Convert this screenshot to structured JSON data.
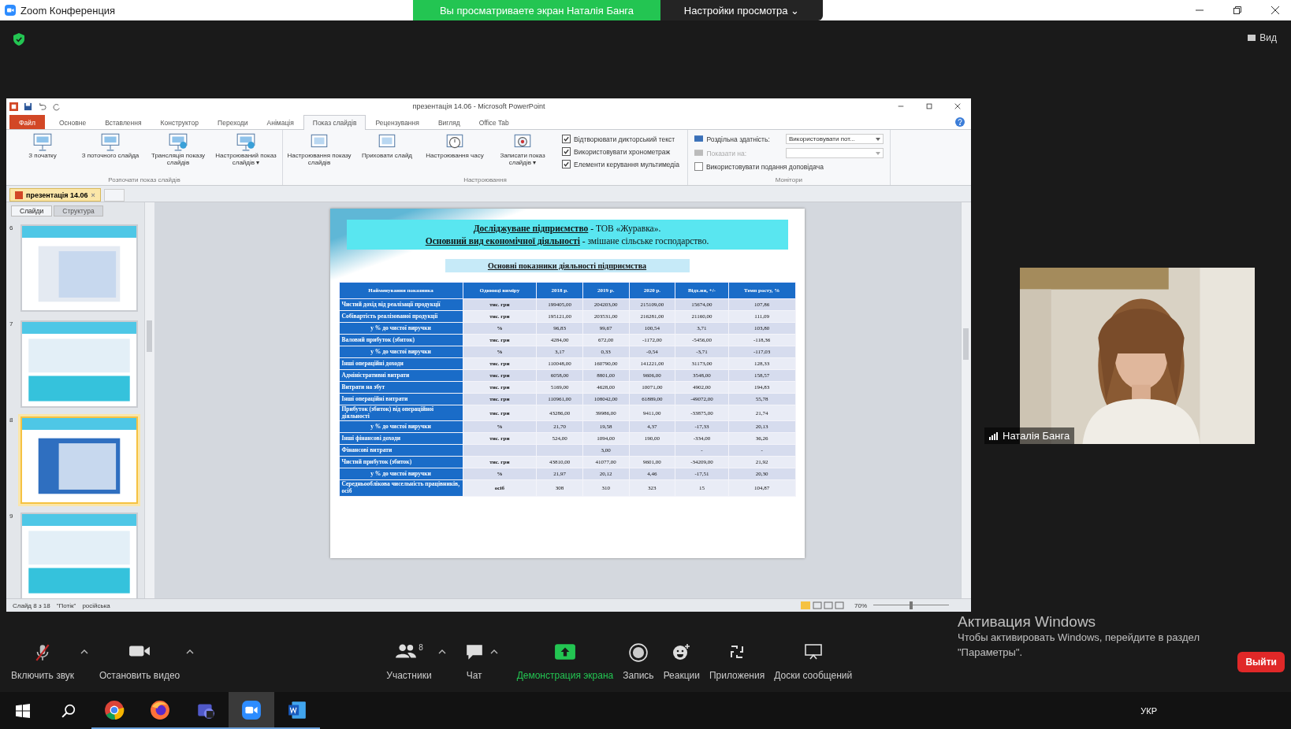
{
  "zoom_window": {
    "title": "Zoom Конференция",
    "banner": "Вы просматриваете экран Наталія Банга",
    "view_options": "Настройки просмотра",
    "view_options_caret": "⌄",
    "view_button": "Вид"
  },
  "powerpoint": {
    "title": "презентація 14.06 - Microsoft PowerPoint",
    "tabs": [
      {
        "label": "Файл",
        "selected": false,
        "kind": "file"
      },
      {
        "label": "Основне",
        "selected": false,
        "kind": "tab"
      },
      {
        "label": "Вставлення",
        "selected": false,
        "kind": "tab"
      },
      {
        "label": "Конструктор",
        "selected": false,
        "kind": "tab"
      },
      {
        "label": "Переходи",
        "selected": false,
        "kind": "tab"
      },
      {
        "label": "Анімація",
        "selected": false,
        "kind": "tab"
      },
      {
        "label": "Показ слайдів",
        "selected": true,
        "kind": "tab"
      },
      {
        "label": "Рецензування",
        "selected": false,
        "kind": "tab"
      },
      {
        "label": "Вигляд",
        "selected": false,
        "kind": "tab"
      },
      {
        "label": "Office Tab",
        "selected": false,
        "kind": "tab"
      }
    ],
    "start_group": {
      "label": "Розпочати показ слайдів",
      "buttons": [
        "З початку",
        "З поточного слайда",
        "Трансляція показу слайдів",
        "Настроюваний показ слайдів ▾"
      ]
    },
    "setup_group": {
      "label": "Настроювання",
      "buttons": [
        "Настроювання показу слайдів",
        "Приховати слайд",
        "Настроювання часу",
        "Записати показ слайдів ▾"
      ],
      "checkboxes": [
        {
          "label": "Відтворювати дикторський текст",
          "checked": true
        },
        {
          "label": "Використовувати хронометраж",
          "checked": true
        },
        {
          "label": "Елементи керування мультимедіа",
          "checked": true
        }
      ]
    },
    "monitors_group": {
      "label": "Монітори",
      "resolution_label": "Роздільна здатність:",
      "resolution_value": "Використовувати пот...",
      "show_on_label": "Показати на:",
      "presenter_view": {
        "label": "Використовувати подання доповідача",
        "checked": false
      }
    },
    "document_tab": "презентація 14.06",
    "document_tab_close": "×",
    "panel_tabs": [
      {
        "label": "Слайди",
        "selected": true
      },
      {
        "label": "Структура",
        "selected": false
      }
    ],
    "slides": [
      {
        "number": "6",
        "selected": false
      },
      {
        "number": "7",
        "selected": false
      },
      {
        "number": "8",
        "selected": true
      },
      {
        "number": "9",
        "selected": false
      }
    ],
    "slide": {
      "heading": [
        "**Досліджуване підприємство** - ТОВ «Журавка».",
        "**Основний вид економічної діяльності** - змішане сільське господарство."
      ],
      "subtitle": "Основні показники діяльності підприємства",
      "table": {
        "columns": [
          "Найменування показника",
          "Одиниці виміру",
          "2018 р.",
          "2019 р.",
          "2020 р.",
          "Відх.ня, +/-",
          "Темп росту, %"
        ],
        "rows": [
          {
            "kind": "main",
            "cells": [
              "Чистий дохід від реалізації продукції",
              "тис. грн",
              "199405,00",
              "204203,00",
              "215109,00",
              "15674,00",
              "107,86"
            ]
          },
          {
            "kind": "main",
            "cells": [
              "Собівартість реалізованої продукції",
              "тис. грн",
              "195121,00",
              "203531,00",
              "216281,00",
              "21160,00",
              "111,09"
            ]
          },
          {
            "kind": "sub",
            "cells": [
              "у % до чистої виручки",
              "%",
              "96,83",
              "99,67",
              "100,54",
              "3,71",
              "103,80"
            ]
          },
          {
            "kind": "main",
            "cells": [
              "Валовий прибуток (збиток)",
              "тис. грн",
              "4284,00",
              "672,00",
              "-1172,00",
              "-5456,00",
              "-118,36"
            ]
          },
          {
            "kind": "sub",
            "cells": [
              "у % до чистої виручки",
              "%",
              "3,17",
              "0,33",
              "-0,54",
              "-3,71",
              "-117,03"
            ]
          },
          {
            "kind": "main",
            "cells": [
              "Інші операційні доходи",
              "тис. грн",
              "110048,00",
              "160790,00",
              "141221,00",
              "31173,00",
              "128,33"
            ]
          },
          {
            "kind": "main",
            "cells": [
              "Адміністративні витрати",
              "тис. грн",
              "6058,00",
              "8801,00",
              "9606,00",
              "3548,00",
              "158,57"
            ]
          },
          {
            "kind": "main",
            "cells": [
              "Витрати на збут",
              "тис. грн",
              "5169,00",
              "4628,00",
              "10071,00",
              "4902,00",
              "194,83"
            ]
          },
          {
            "kind": "main",
            "cells": [
              "Інші операційні витрати",
              "тис. грн",
              "110961,00",
              "108042,00",
              "61889,00",
              "-49072,00",
              "55,78"
            ]
          },
          {
            "kind": "main",
            "cells": [
              "Прибуток (збиток) від операційної діяльності",
              "тис. грн",
              "43286,00",
              "39986,00",
              "9411,00",
              "-33875,00",
              "21,74"
            ]
          },
          {
            "kind": "sub",
            "cells": [
              "у % до чистої виручки",
              "%",
              "21,70",
              "19,58",
              "4,37",
              "-17,33",
              "20,13"
            ]
          },
          {
            "kind": "main",
            "cells": [
              "Інші фінансові доходи",
              "тис. грн",
              "524,00",
              "1094,00",
              "190,00",
              "-334,00",
              "36,26"
            ]
          },
          {
            "kind": "main",
            "cells": [
              "Фінансові витрати",
              "",
              "",
              "3,00",
              "",
              "-",
              "-"
            ]
          },
          {
            "kind": "main",
            "cells": [
              "Чистий прибуток (збиток)",
              "тис. грн",
              "43810,00",
              "41077,00",
              "9601,00",
              "-34209,00",
              "21,92"
            ]
          },
          {
            "kind": "sub",
            "cells": [
              "у % до чистої виручки",
              "%",
              "21,97",
              "20,12",
              "4,46",
              "-17,51",
              "20,30"
            ]
          },
          {
            "kind": "main",
            "cells": [
              "Середньооблікова чисельність працівників, осіб",
              "осіб",
              "308",
              "310",
              "323",
              "15",
              "104,87"
            ]
          }
        ]
      }
    },
    "status": [
      "Слайд 8 з 18",
      "\"Потік\"",
      "російська"
    ],
    "zoom_level": "70%",
    "zoom_slider": {
      "level": 0.5
    }
  },
  "participant": {
    "name": "Наталія Банга"
  },
  "toolbar": [
    {
      "kind": "mic",
      "label": "Включить звук",
      "muted": true,
      "menu": true
    },
    {
      "kind": "video",
      "label": "Остановить видео",
      "muted": false,
      "menu": true
    },
    {
      "kind": "participants",
      "label": "Участники",
      "count": "8",
      "menu": true
    },
    {
      "kind": "chat",
      "label": "Чат",
      "menu": true
    },
    {
      "kind": "share",
      "label": "Демонстрация экрана",
      "menu": false
    },
    {
      "kind": "record",
      "label": "Запись",
      "menu": false
    },
    {
      "kind": "reactions",
      "label": "Реакции",
      "menu": false
    },
    {
      "kind": "apps",
      "label": "Приложения",
      "menu": false
    },
    {
      "kind": "whiteboard",
      "label": "Доски сообщений",
      "menu": false
    }
  ],
  "leave_button": "Выйти",
  "activation": {
    "title": "Активация Windows",
    "text": "Чтобы активировать Windows, перейдите в раздел \"Параметры\"."
  },
  "taskbar": {
    "apps": [
      {
        "kind": "chrome",
        "active": false
      },
      {
        "kind": "firefox",
        "active": false
      },
      {
        "kind": "teams",
        "active": false
      },
      {
        "kind": "zoom",
        "active": true
      },
      {
        "kind": "word",
        "active": false
      }
    ],
    "language": "УКР"
  }
}
